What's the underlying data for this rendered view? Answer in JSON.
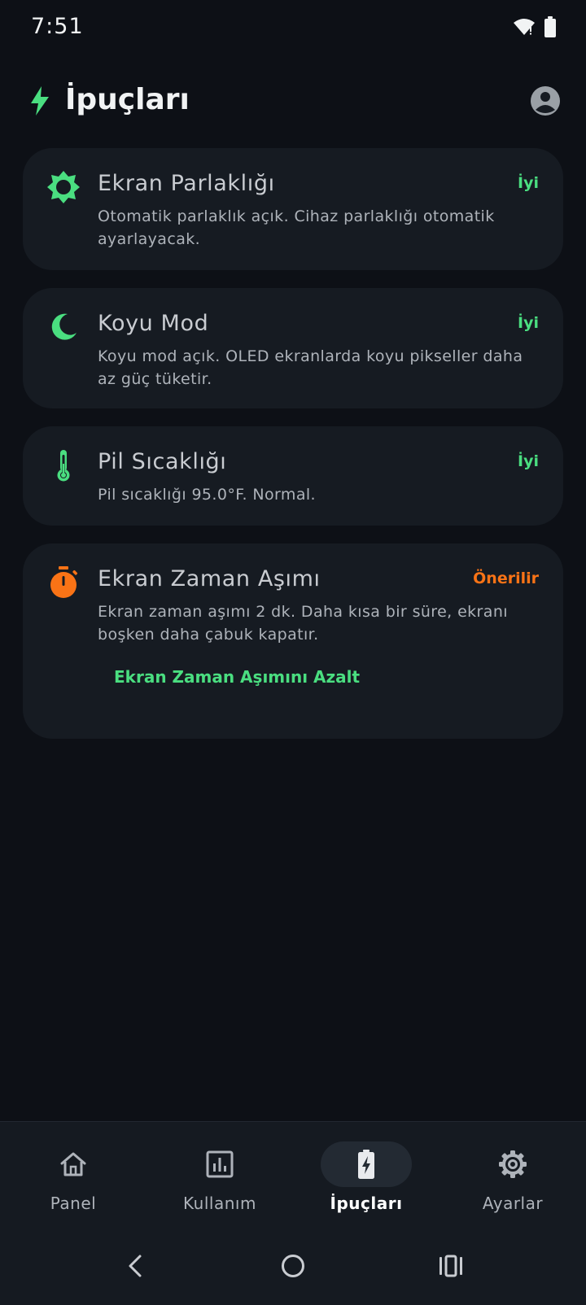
{
  "status_bar": {
    "time": "7:51"
  },
  "header": {
    "title": "İpuçları"
  },
  "tips": [
    {
      "icon": "brightness-icon",
      "title": "Ekran Parlaklığı",
      "status": "İyi",
      "description": "Otomatik parlaklık açık. Cihaz parlaklığı otomatik ayarlayacak."
    },
    {
      "icon": "moon-icon",
      "title": "Koyu Mod",
      "status": "İyi",
      "description": "Koyu mod açık. OLED ekranlarda koyu pikseller daha az güç tüketir."
    },
    {
      "icon": "thermometer-icon",
      "title": "Pil Sıcaklığı",
      "status": "İyi",
      "description": "Pil sıcaklığı 95.0°F. Normal."
    },
    {
      "icon": "timer-icon",
      "title": "Ekran Zaman Aşımı",
      "status": "Önerilir",
      "description": "Ekran zaman aşımı 2 dk. Daha kısa bir süre, ekranı boşken daha çabuk kapatır.",
      "action": "Ekran Zaman Aşımını Azalt"
    }
  ],
  "bottom_nav": {
    "items": [
      {
        "label": "Panel",
        "icon": "home-icon"
      },
      {
        "label": "Kullanım",
        "icon": "bar-chart-icon"
      },
      {
        "label": "İpuçları",
        "icon": "battery-bolt-icon",
        "active": true
      },
      {
        "label": "Ayarlar",
        "icon": "gear-icon"
      }
    ]
  },
  "colors": {
    "background": "#0d1016",
    "card": "#161b22",
    "accent_green": "#4ade80",
    "accent_orange": "#f97316",
    "text_primary": "#f1f3f4",
    "text_secondary": "#aeb3ba"
  }
}
